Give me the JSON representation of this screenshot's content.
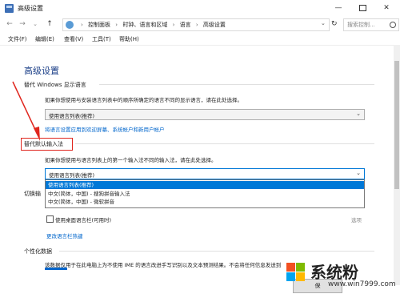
{
  "window": {
    "title": "高级设置",
    "minimize_glyph": "—",
    "close_glyph": "✕"
  },
  "nav": {
    "back_glyph": "←",
    "forward_glyph": "→",
    "recent_glyph": "⌄",
    "up_glyph": "↑",
    "breadcrumbs": [
      "控制面板",
      "时钟、语言和区域",
      "语言",
      "高级设置"
    ],
    "refresh_glyph": "↻",
    "search_placeholder": "搜索控制..."
  },
  "menu": {
    "items": [
      "文件(F)",
      "编辑(E)",
      "查看(V)",
      "工具(T)",
      "帮助(H)"
    ]
  },
  "page": {
    "title": "高级设置",
    "display_language": {
      "label": "替代 Windows 显示语言",
      "description": "如果你想使用与安装语言列表中的顺序所确定的语言不同的显示语言，请在此处选择。",
      "selected": "使用语言列表(推荐)",
      "link": "将语言设置应用到欢迎屏幕、系统帐户和新用户帐户"
    },
    "input_method": {
      "label": "替代默认输入法",
      "description": "如果你想使用与语言列表上的第一个输入法不同的输入法，请在此处选择。",
      "selected": "使用语言列表(推荐)",
      "options": [
        "使用语言列表(推荐)",
        "中文(简体，中国) - 搜狗拼音输入法",
        "中文(简体，中国) - 微软拼音"
      ]
    },
    "switch_label": "切换输",
    "desktop_langbar": {
      "label": "使用桌面语言栏(可用时)",
      "options_link": "选项",
      "hotkey_link": "更改语言栏热键"
    },
    "personalization": {
      "label": "个性化数据",
      "description": "该数据仅用于在此电脑上为不使用 IME 的语言改进手写识别以及文本预测结果。不会将任何信息发送到"
    },
    "save_button": "保"
  },
  "watermark": {
    "text": "系统粉",
    "url": "www.win7999.com",
    "colors": [
      "#f25022",
      "#7fba00",
      "#00a4ef",
      "#ffb900"
    ]
  },
  "colors": {
    "accent": "#0078d7",
    "annotation_red": "#e0261e",
    "title_blue": "#1a3e87"
  }
}
